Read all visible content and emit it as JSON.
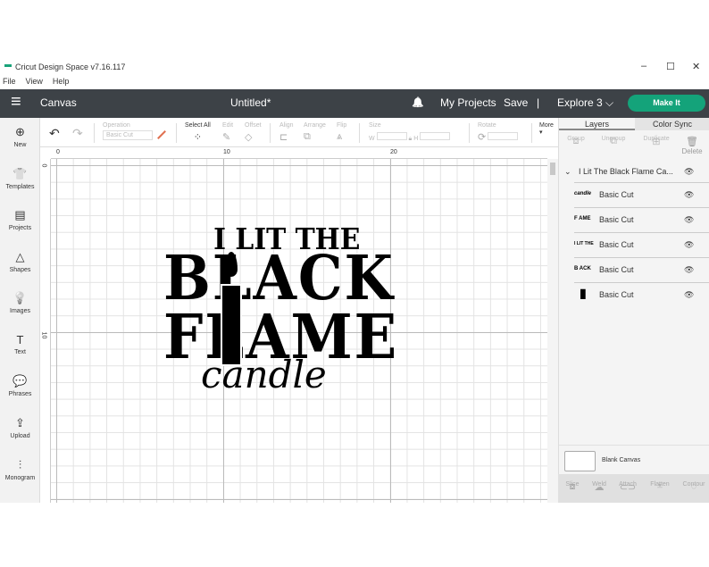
{
  "window": {
    "title": "Cricut Design Space  v7.16.117",
    "minimize": "–",
    "maximize": "☐",
    "close": "✕"
  },
  "menu": [
    "File",
    "View",
    "Help"
  ],
  "header": {
    "menu_icon": "≡",
    "section": "Canvas",
    "doc_title": "Untitled*",
    "bell": "🔔",
    "my_projects": "My Projects",
    "save": "Save",
    "divider": "|",
    "machine": "Explore 3 ⌵",
    "make_it": "Make It"
  },
  "toolbar": {
    "undo": "↶",
    "redo": "↷",
    "operation_label": "Operation",
    "operation_value": "Basic Cut",
    "select_all": "Select All",
    "edit": "Edit",
    "offset": "Offset",
    "align": "Align",
    "arrange": "Arrange",
    "flip": "Flip",
    "size": "Size",
    "w": "W",
    "h": "H",
    "rotate": "Rotate",
    "more": "More"
  },
  "sidebar": [
    {
      "label": "New",
      "icon": "⊕"
    },
    {
      "label": "Templates",
      "icon": "👕"
    },
    {
      "label": "Projects",
      "icon": "▤"
    },
    {
      "label": "Shapes",
      "icon": "△"
    },
    {
      "label": "Images",
      "icon": "💡"
    },
    {
      "label": "Text",
      "icon": "T"
    },
    {
      "label": "Phrases",
      "icon": "💬"
    },
    {
      "label": "Upload",
      "icon": "⇪"
    },
    {
      "label": "Monogram",
      "icon": "⫶"
    }
  ],
  "rulers": {
    "top": [
      "0",
      "10",
      "20"
    ],
    "left": [
      "0",
      "10"
    ]
  },
  "design": {
    "line1": "I LIT THE",
    "line2": "BLACK",
    "line3": "FLAME",
    "line4": "candle"
  },
  "panel": {
    "tabs": [
      "Layers",
      "Color Sync"
    ],
    "tools": [
      "Group",
      "Ungroup",
      "Duplicate",
      "Delete"
    ],
    "group_name": "I Lit The Black Flame Ca...",
    "layers": [
      {
        "thumb": "candle",
        "label": "Basic Cut"
      },
      {
        "thumb": "F AME",
        "label": "Basic Cut"
      },
      {
        "thumb": "I LIT THE",
        "label": "Basic Cut"
      },
      {
        "thumb": "B ACK",
        "label": "Basic Cut"
      },
      {
        "thumb": "▮",
        "label": "Basic Cut"
      }
    ],
    "blank_canvas": "Blank Canvas",
    "bottom_tools": [
      "Slice",
      "Weld",
      "Attach",
      "Flatten",
      "Contour"
    ]
  }
}
